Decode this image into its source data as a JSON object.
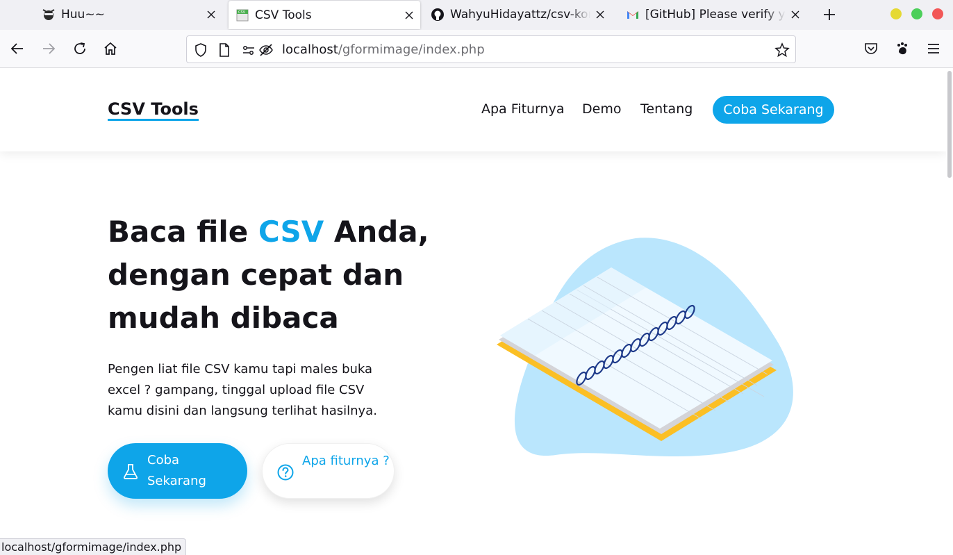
{
  "browser": {
    "tabs": [
      {
        "title": "Huu~~",
        "icon": "ninja-favicon",
        "active": false
      },
      {
        "title": "CSV Tools",
        "icon": "csv-favicon",
        "active": true
      },
      {
        "title": "WahyuHidayattz/csv-konv",
        "icon": "github-icon",
        "active": false
      },
      {
        "title": "[GitHub] Please verify you",
        "icon": "gmail-icon",
        "active": false
      }
    ],
    "url_host": "localhost",
    "url_path": "/gformimage/index.php",
    "status_url": "localhost/gformimage/index.php"
  },
  "site": {
    "logo": "CSV Tools",
    "nav": [
      "Apa Fiturnya",
      "Demo",
      "Tentang"
    ],
    "nav_cta": "Coba Sekarang",
    "hero": {
      "title_part1": "Baca file ",
      "title_accent": "CSV",
      "title_part2": " Anda, dengan cepat dan mudah ",
      "title_bold": "dibaca",
      "description": "Pengen liat file CSV kamu tapi males buka excel ? gampang, tinggal upload file CSV kamu disini dan langsung terlihat hasilnya.",
      "primary_button": "Coba Sekarang",
      "primary_icon": "flask-icon",
      "secondary_button": "Apa fiturnya ?",
      "secondary_icon": "question-circle-icon"
    }
  },
  "colors": {
    "accent": "#0ea5e9",
    "blob": "#bae6fd",
    "notebook_edge": "#fbbf24"
  }
}
